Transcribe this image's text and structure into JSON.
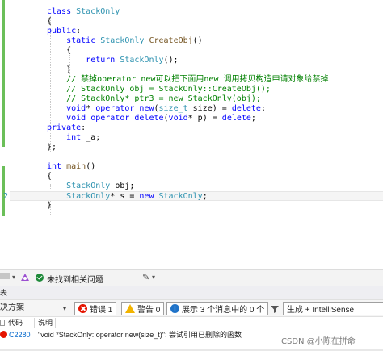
{
  "editor": {
    "lines": [
      {
        "tokens": [
          {
            "t": "class ",
            "c": "kw"
          },
          {
            "t": "StackOnly",
            "c": "type"
          }
        ]
      },
      {
        "tokens": [
          {
            "t": "{",
            "c": "pl"
          }
        ]
      },
      {
        "tokens": [
          {
            "t": "public",
            "c": "kw"
          },
          {
            "t": ":",
            "c": "pl"
          }
        ]
      },
      {
        "tokens": [
          {
            "t": "    ",
            "c": "pl"
          },
          {
            "t": "static ",
            "c": "kw"
          },
          {
            "t": "StackOnly ",
            "c": "type"
          },
          {
            "t": "CreateObj",
            "c": "fn"
          },
          {
            "t": "()",
            "c": "pl"
          }
        ]
      },
      {
        "tokens": [
          {
            "t": "    {",
            "c": "pl"
          }
        ]
      },
      {
        "tokens": [
          {
            "t": "        ",
            "c": "pl"
          },
          {
            "t": "return ",
            "c": "kw"
          },
          {
            "t": "StackOnly",
            "c": "type"
          },
          {
            "t": "();",
            "c": "pl"
          }
        ]
      },
      {
        "tokens": [
          {
            "t": "    }",
            "c": "pl"
          }
        ]
      },
      {
        "tokens": [
          {
            "t": "    ",
            "c": "pl"
          },
          {
            "t": "// 禁掉operator new可以把下面用new 调用拷贝构造申请对象给禁掉",
            "c": "cm"
          }
        ]
      },
      {
        "tokens": [
          {
            "t": "    ",
            "c": "pl"
          },
          {
            "t": "// StackOnly obj = StackOnly::CreateObj();",
            "c": "cm"
          }
        ]
      },
      {
        "tokens": [
          {
            "t": "    ",
            "c": "pl"
          },
          {
            "t": "// StackOnly* ptr3 = new StackOnly(obj);",
            "c": "cm"
          }
        ]
      },
      {
        "tokens": [
          {
            "t": "    ",
            "c": "pl"
          },
          {
            "t": "void",
            "c": "kw"
          },
          {
            "t": "* ",
            "c": "pl"
          },
          {
            "t": "operator new",
            "c": "kw"
          },
          {
            "t": "(",
            "c": "pl"
          },
          {
            "t": "size_t",
            "c": "type"
          },
          {
            "t": " size) = ",
            "c": "pl"
          },
          {
            "t": "delete",
            "c": "kw"
          },
          {
            "t": ";",
            "c": "pl"
          }
        ]
      },
      {
        "tokens": [
          {
            "t": "    ",
            "c": "pl"
          },
          {
            "t": "void ",
            "c": "kw"
          },
          {
            "t": "operator delete",
            "c": "kw"
          },
          {
            "t": "(",
            "c": "pl"
          },
          {
            "t": "void",
            "c": "kw"
          },
          {
            "t": "* p) = ",
            "c": "pl"
          },
          {
            "t": "delete",
            "c": "kw"
          },
          {
            "t": ";",
            "c": "pl"
          }
        ]
      },
      {
        "tokens": [
          {
            "t": "private",
            "c": "kw"
          },
          {
            "t": ":",
            "c": "pl"
          }
        ]
      },
      {
        "tokens": [
          {
            "t": "    ",
            "c": "pl"
          },
          {
            "t": "int ",
            "c": "kw"
          },
          {
            "t": "_a;",
            "c": "pl"
          }
        ]
      },
      {
        "tokens": [
          {
            "t": "};",
            "c": "pl"
          }
        ]
      },
      {
        "tokens": []
      },
      {
        "tokens": [
          {
            "t": "int ",
            "c": "kw"
          },
          {
            "t": "main",
            "c": "fn"
          },
          {
            "t": "()",
            "c": "pl"
          }
        ]
      },
      {
        "tokens": [
          {
            "t": "{",
            "c": "pl"
          }
        ]
      },
      {
        "tokens": [
          {
            "t": "    ",
            "c": "pl"
          },
          {
            "t": "StackOnly ",
            "c": "type"
          },
          {
            "t": "obj;",
            "c": "pl"
          }
        ]
      },
      {
        "tokens": [
          {
            "t": "    ",
            "c": "pl"
          },
          {
            "t": "StackOnly",
            "c": "type"
          },
          {
            "t": "* s = ",
            "c": "pl"
          },
          {
            "t": "new ",
            "c": "kw"
          },
          {
            "t": "StackOnly",
            "c": "type"
          },
          {
            "t": ";",
            "c": "pl"
          }
        ]
      },
      {
        "tokens": [
          {
            "t": "}",
            "c": "pl"
          }
        ]
      }
    ],
    "visible_line_numbers": [
      {
        "line_index": 19,
        "text": "2"
      }
    ],
    "current_line_index": 19,
    "colors": {
      "keyword": "#0000ff",
      "type": "#2b91af",
      "function": "#74531f",
      "comment": "#008000",
      "change_bar": "#6bbf59"
    }
  },
  "status_bar": {
    "issues_text": "未找到相关问题",
    "ok_icon": "check-circle-icon",
    "brush_icon": "paint-brush-icon"
  },
  "error_panel": {
    "title": "表",
    "scope_label": "决方案",
    "errors_label": "错误 1",
    "warnings_label": "警告 0",
    "messages_label": "展示 3 个消息中的 0 个",
    "build_filter_label": "生成 + IntelliSense",
    "columns": [
      "代码",
      "说明"
    ],
    "rows": [
      {
        "code": "C2280",
        "description": "\"void *StackOnly::operator new(size_t)\": 尝试引用已删除的函数"
      }
    ]
  },
  "watermark": {
    "text": "CSDN @小陈在拼命"
  }
}
